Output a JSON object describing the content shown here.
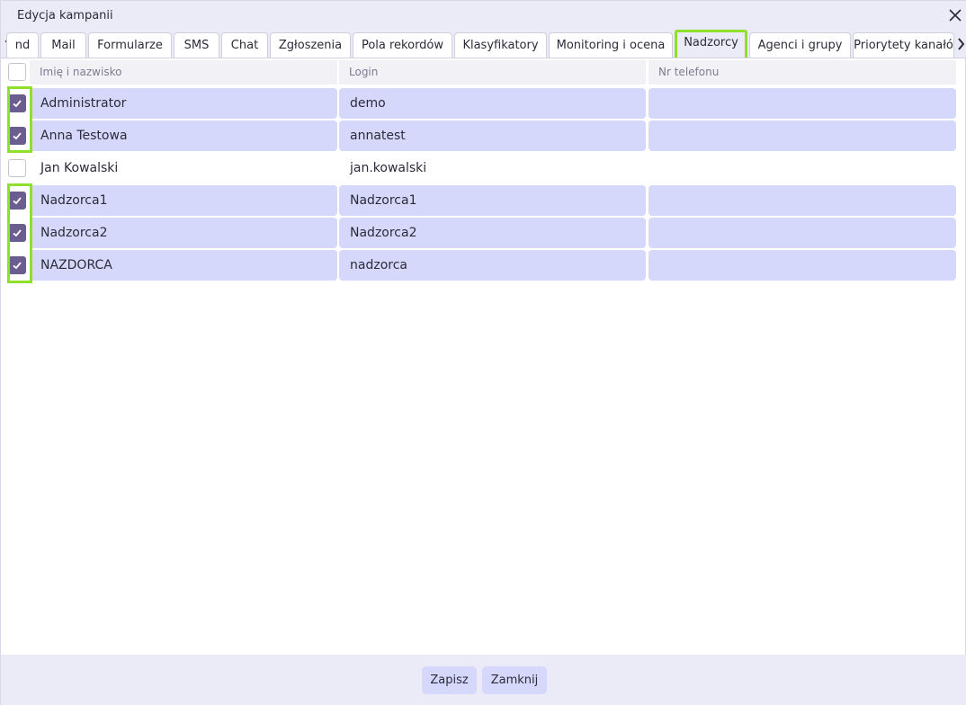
{
  "dialog": {
    "title": "Edycja kampanii"
  },
  "tabs": [
    {
      "label": "nd",
      "active": false
    },
    {
      "label": "Mail",
      "active": false
    },
    {
      "label": "Formularze",
      "active": false
    },
    {
      "label": "SMS",
      "active": false
    },
    {
      "label": "Chat",
      "active": false
    },
    {
      "label": "Zgłoszenia",
      "active": false
    },
    {
      "label": "Pola rekordów",
      "active": false
    },
    {
      "label": "Klasyfikatory",
      "active": false
    },
    {
      "label": "Monitoring i ocena",
      "active": false
    },
    {
      "label": "Nadzorcy",
      "active": true
    },
    {
      "label": "Agenci i grupy",
      "active": false
    },
    {
      "label": "Priorytety kanałó",
      "active": false
    }
  ],
  "table": {
    "columns": [
      "Imię i nazwisko",
      "Login",
      "Nr telefonu"
    ],
    "rows": [
      {
        "name": "Administrator",
        "login": "demo",
        "phone": "",
        "checked": true
      },
      {
        "name": "Anna Testowa",
        "login": "annatest",
        "phone": "",
        "checked": true
      },
      {
        "name": "Jan Kowalski",
        "login": "jan.kowalski",
        "phone": "",
        "checked": false
      },
      {
        "name": "Nadzorca1",
        "login": "Nadzorca1",
        "phone": "",
        "checked": true
      },
      {
        "name": "Nadzorca2",
        "login": "Nadzorca2",
        "phone": "",
        "checked": true
      },
      {
        "name": "NAZDORCA",
        "login": "nadzorca",
        "phone": "",
        "checked": true
      }
    ]
  },
  "footer": {
    "save_label": "Zapisz",
    "close_label": "Zamknij"
  },
  "colors": {
    "accent": "#6b5d8e",
    "selected_row": "#d6d8fb",
    "highlight": "#8ee02a",
    "chrome": "#ebebf7"
  }
}
